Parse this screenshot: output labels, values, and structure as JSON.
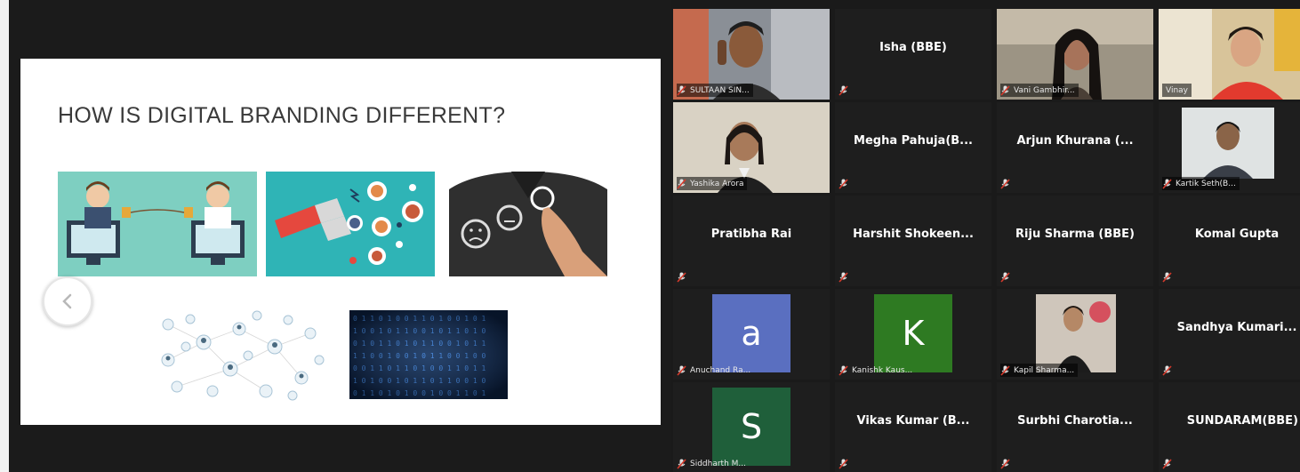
{
  "slide": {
    "title": "HOW IS DIGITAL BRANDING DIFFERENT?",
    "images": [
      "business-people-talking-image",
      "magnet-attracting-people-image",
      "finger-pressing-emoji-buttons-image",
      "social-network-people-image",
      "binary-code-image"
    ]
  },
  "controls": {
    "prev_icon": "chevron-left-icon"
  },
  "colors": {
    "active_speaker_border": "#d8c94a",
    "avatar_a": "#5a6fc0",
    "avatar_k": "#2e7a22",
    "avatar_s": "#1f5f3a",
    "tile_bg": "#1e1e1e",
    "muted_icon": "#c0392b"
  },
  "participants": [
    {
      "name": "SULTAAN SIN...",
      "type": "video"
    },
    {
      "name": "Isha (BBE)",
      "type": "name"
    },
    {
      "name": "Vani Gambhir...",
      "type": "video"
    },
    {
      "name": "Vinay",
      "type": "video",
      "active": true
    },
    {
      "name": "Yashika Arora",
      "type": "video"
    },
    {
      "name": "Megha  Pahuja(B...",
      "type": "name"
    },
    {
      "name": "Arjun Khurana (...",
      "type": "name"
    },
    {
      "name": "Kartik Seth(B...",
      "type": "video"
    },
    {
      "name": "Pratibha Rai",
      "type": "name"
    },
    {
      "name": "Harshit  Shokeen...",
      "type": "name"
    },
    {
      "name": "Riju Sharma (BBE)",
      "type": "name"
    },
    {
      "name": "Komal Gupta",
      "type": "name"
    },
    {
      "name": "Anuchand Ra...",
      "type": "avatar",
      "letter": "a"
    },
    {
      "name": "Kanishk Kaus...",
      "type": "avatar",
      "letter": "K"
    },
    {
      "name": "Kapil Sharma...",
      "type": "video"
    },
    {
      "name": "Sandhya  Kumari...",
      "type": "name"
    },
    {
      "name": "Siddharth M...",
      "type": "avatar",
      "letter": "S"
    },
    {
      "name": "Vikas Kumar (B...",
      "type": "name"
    },
    {
      "name": "Surbhi  Charotia...",
      "type": "name"
    },
    {
      "name": "SUNDARAM(BBE)",
      "type": "name"
    }
  ]
}
